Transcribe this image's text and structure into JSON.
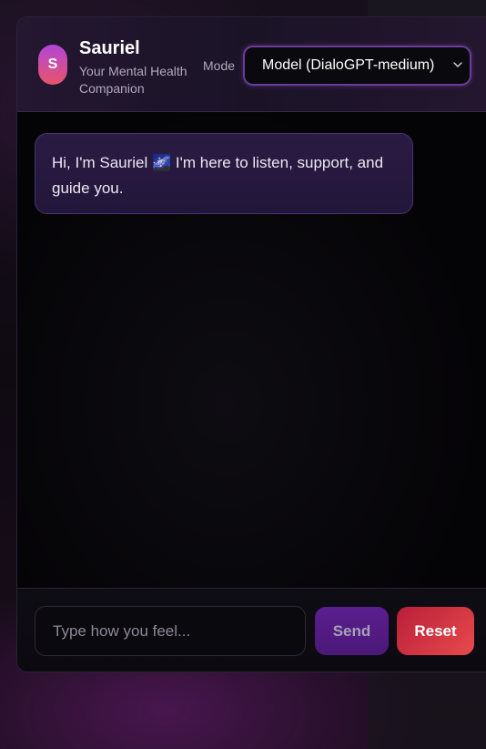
{
  "brand": {
    "avatar_letter": "S",
    "title": "Sauriel",
    "subtitle": "Your Mental Health Companion"
  },
  "mode": {
    "label": "Mode",
    "selected": "Model (DialoGPT-medium)"
  },
  "messages": [
    {
      "role": "assistant",
      "text": "Hi, I'm Sauriel 🌌 I'm here to listen, support, and guide you."
    }
  ],
  "composer": {
    "placeholder": "Type how you feel...",
    "value": "",
    "send_label": "Send",
    "reset_label": "Reset"
  },
  "colors": {
    "accent_purple": "#6a3b9a",
    "send_bg": "#5a1f8f",
    "reset_bg": "#e84b4b",
    "bubble_bg": "#2a1b43"
  },
  "icons": {
    "select_arrow": "chevron-down-icon"
  }
}
